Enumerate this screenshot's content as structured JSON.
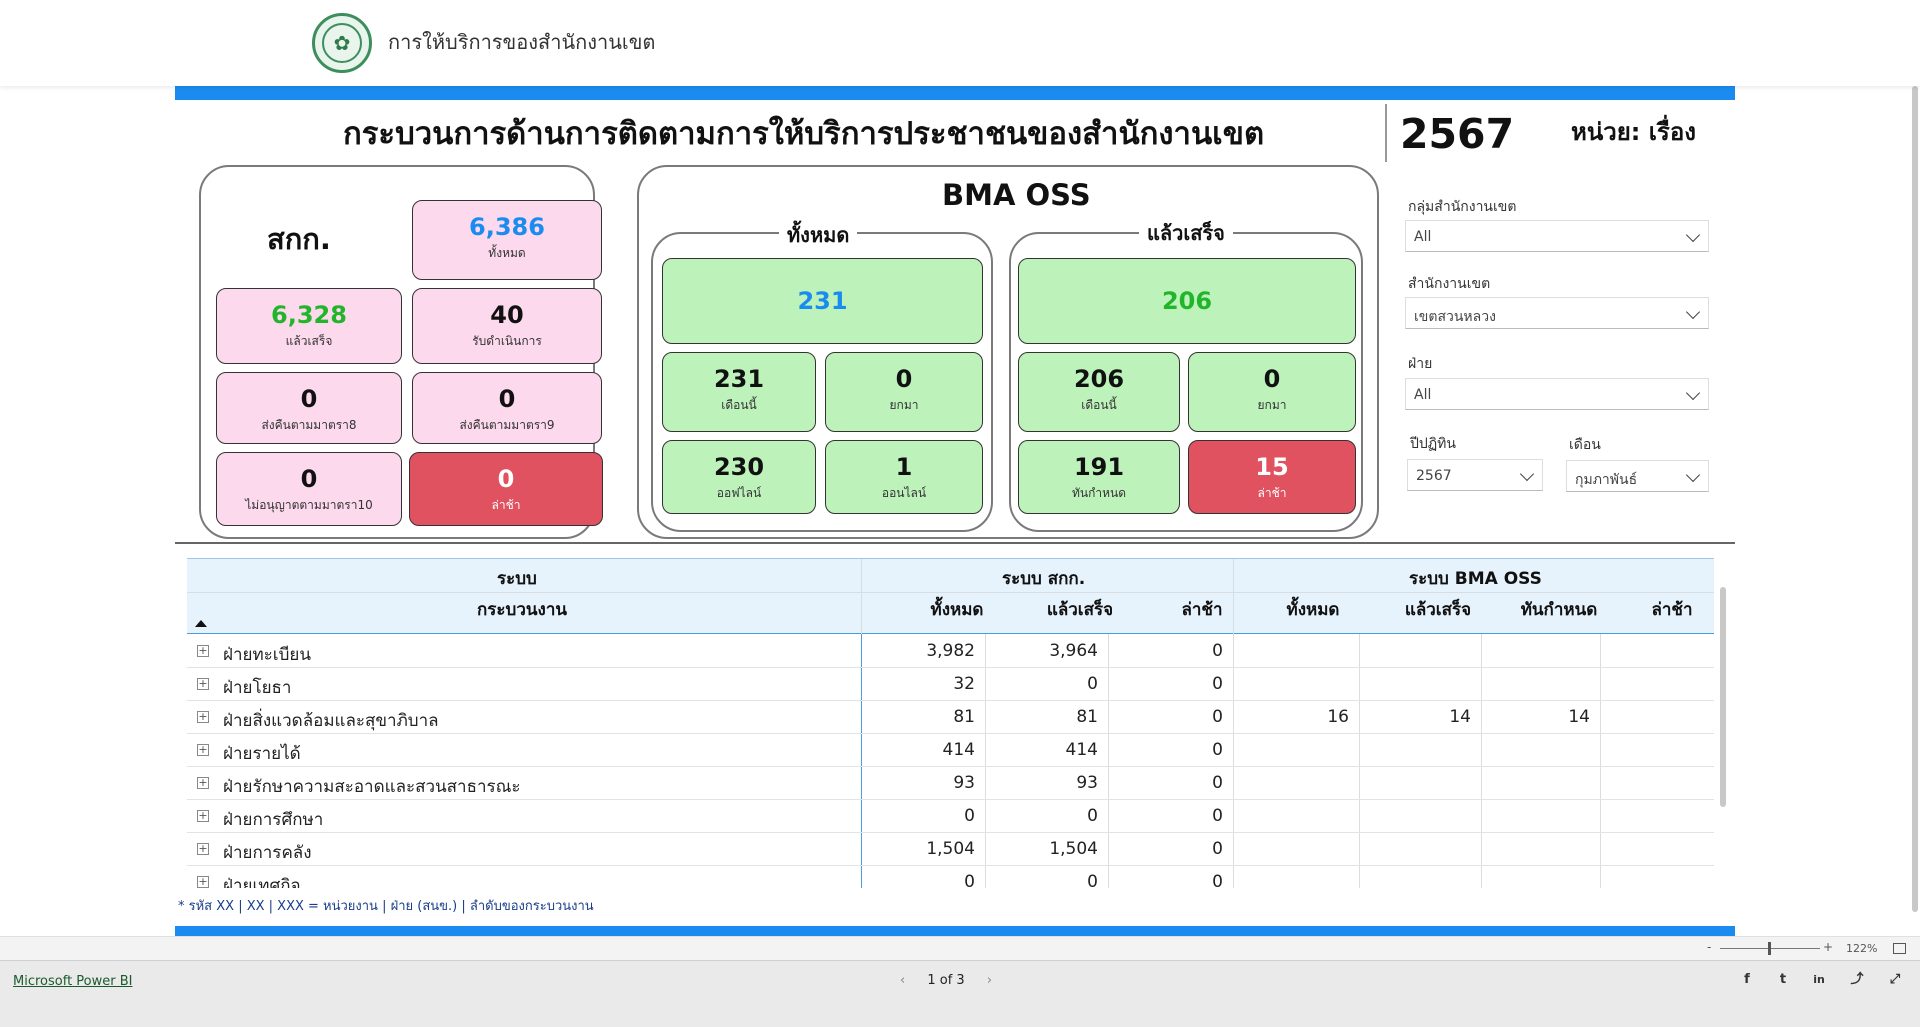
{
  "header": {
    "site_title": "การให้บริการของสำนักงานเขต",
    "logo": "bma-seal-logo"
  },
  "report": {
    "title": "กระบวนการด้านการติดตามการให้บริการประชาชนของสำนักงานเขต",
    "year": "2567",
    "unit": "หน่วย: เรื่อง",
    "footnote": "* รหัส XX | XX | XXX = หน่วยงาน | ฝ่าย (สนข.) | ลำดับของกระบวนงาน"
  },
  "skk": {
    "label": "สกก.",
    "cards": [
      {
        "value": "6,386",
        "label": "ทั้งหมด"
      },
      {
        "value": "6,328",
        "label": "แล้วเสร็จ"
      },
      {
        "value": "40",
        "label": "รับดำเนินการ"
      },
      {
        "value": "0",
        "label": "ส่งคืนตามมาตรา8"
      },
      {
        "value": "0",
        "label": "ส่งคืนตามมาตรา9"
      },
      {
        "value": "0",
        "label": "ไม่อนุญาตตามมาตรา10"
      },
      {
        "value": "0",
        "label": "ล่าช้า"
      }
    ]
  },
  "bma": {
    "title": "BMA OSS",
    "all": {
      "title": "ทั้งหมด",
      "total": "231",
      "cards": [
        {
          "value": "231",
          "label": "เดือนนี้"
        },
        {
          "value": "0",
          "label": "ยกมา"
        },
        {
          "value": "230",
          "label": "ออฟไลน์"
        },
        {
          "value": "1",
          "label": "ออนไลน์"
        }
      ]
    },
    "done": {
      "title": "แล้วเสร็จ",
      "total": "206",
      "cards": [
        {
          "value": "206",
          "label": "เดือนนี้"
        },
        {
          "value": "0",
          "label": "ยกมา"
        },
        {
          "value": "191",
          "label": "ทันกำหนด"
        },
        {
          "value": "15",
          "label": "ล่าช้า"
        }
      ]
    }
  },
  "filters": {
    "group_label": "กลุ่มสำนักงานเขต",
    "group_value": "All",
    "office_label": "สำนักงานเขต",
    "office_value": "เขตสวนหลวง",
    "dept_label": "ฝ่าย",
    "dept_value": "All",
    "year_label": "ปีปฏิทิน",
    "year_value": "2567",
    "month_label": "เดือน",
    "month_value": "กุมภาพันธ์"
  },
  "table": {
    "h_system": "ระบบ",
    "h_process": "กระบวนงาน",
    "h_skk": "ระบบ สกก.",
    "h_bma": "ระบบ BMA OSS",
    "columns": [
      "ทั้งหมด",
      "แล้วเสร็จ",
      "ล่าช้า",
      "ทั้งหมด",
      "แล้วเสร็จ",
      "ทันกำหนด",
      "ล่าช้า"
    ],
    "rows": [
      {
        "name": "ฝ่ายทะเบียน",
        "c": [
          "3,982",
          "3,964",
          "0",
          "",
          "",
          "",
          ""
        ]
      },
      {
        "name": "ฝ่ายโยธา",
        "c": [
          "32",
          "0",
          "0",
          "",
          "",
          "",
          ""
        ]
      },
      {
        "name": "ฝ่ายสิ่งแวดล้อมและสุขาภิบาล",
        "c": [
          "81",
          "81",
          "0",
          "16",
          "14",
          "14",
          ""
        ]
      },
      {
        "name": "ฝ่ายรายได้",
        "c": [
          "414",
          "414",
          "0",
          "",
          "",
          "",
          ""
        ]
      },
      {
        "name": "ฝ่ายรักษาความสะอาดและสวนสาธารณะ",
        "c": [
          "93",
          "93",
          "0",
          "",
          "",
          "",
          ""
        ]
      },
      {
        "name": "ฝ่ายการศึกษา",
        "c": [
          "0",
          "0",
          "0",
          "",
          "",
          "",
          ""
        ]
      },
      {
        "name": "ฝ่ายการคลัง",
        "c": [
          "1,504",
          "1,504",
          "0",
          "",
          "",
          "",
          ""
        ]
      },
      {
        "name": "ฝ่ายเทศกิจ",
        "c": [
          "0",
          "0",
          "0",
          "",
          "",
          "",
          ""
        ]
      }
    ]
  },
  "footer": {
    "brand": "Microsoft Power BI",
    "page": "1 of 3",
    "zoom": "122%",
    "prev": "‹",
    "next": "›",
    "social": [
      "f",
      "t",
      "in",
      "share",
      "expand"
    ]
  }
}
